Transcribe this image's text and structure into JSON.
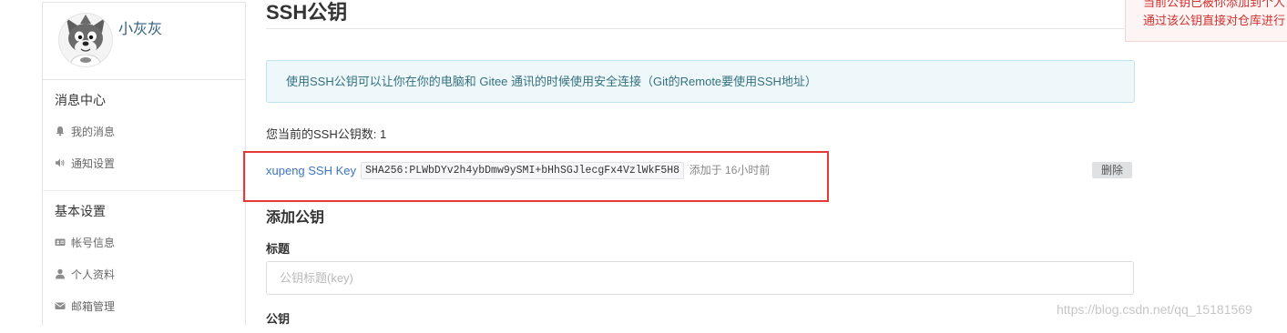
{
  "sidebar": {
    "user": {
      "name": "小灰灰"
    },
    "sections": [
      {
        "title": "消息中心",
        "items": [
          {
            "label": "我的消息",
            "icon": "bell-icon"
          },
          {
            "label": "通知设置",
            "icon": "volume-icon"
          }
        ]
      },
      {
        "title": "基本设置",
        "items": [
          {
            "label": "帐号信息",
            "icon": "id-card-icon"
          },
          {
            "label": "个人资料",
            "icon": "user-icon"
          },
          {
            "label": "邮箱管理",
            "icon": "envelope-icon"
          }
        ]
      }
    ]
  },
  "main": {
    "title": "SSH公钥",
    "info": "使用SSH公钥可以让你在你的电脑和 Gitee 通讯的时候使用安全连接（Git的Remote要使用SSH地址）",
    "count_label": "您当前的SSH公钥数: 1",
    "keys": [
      {
        "name": "xupeng SSH Key",
        "fingerprint": "SHA256:PLWbDYv2h4ybDmw9ySMI+bHhSGJlecgFx4VzlWkF5H8",
        "added": "添加于 16小时前",
        "delete_label": "删除"
      }
    ],
    "add_form": {
      "heading": "添加公钥",
      "title_label": "标题",
      "title_placeholder": "公钥标题(key)",
      "title_value": "",
      "key_label": "公钥"
    }
  },
  "alert": {
    "lines": [
      "当前公钥已被你添加到个人",
      "通过该公钥直接对仓库进行"
    ]
  },
  "watermark": "https://blog.csdn.net/qq_15181569",
  "colors": {
    "accent": "#3c76c2",
    "username": "#2f5d7c",
    "highlight_border": "#e53935",
    "alert_text": "#d0312d"
  }
}
